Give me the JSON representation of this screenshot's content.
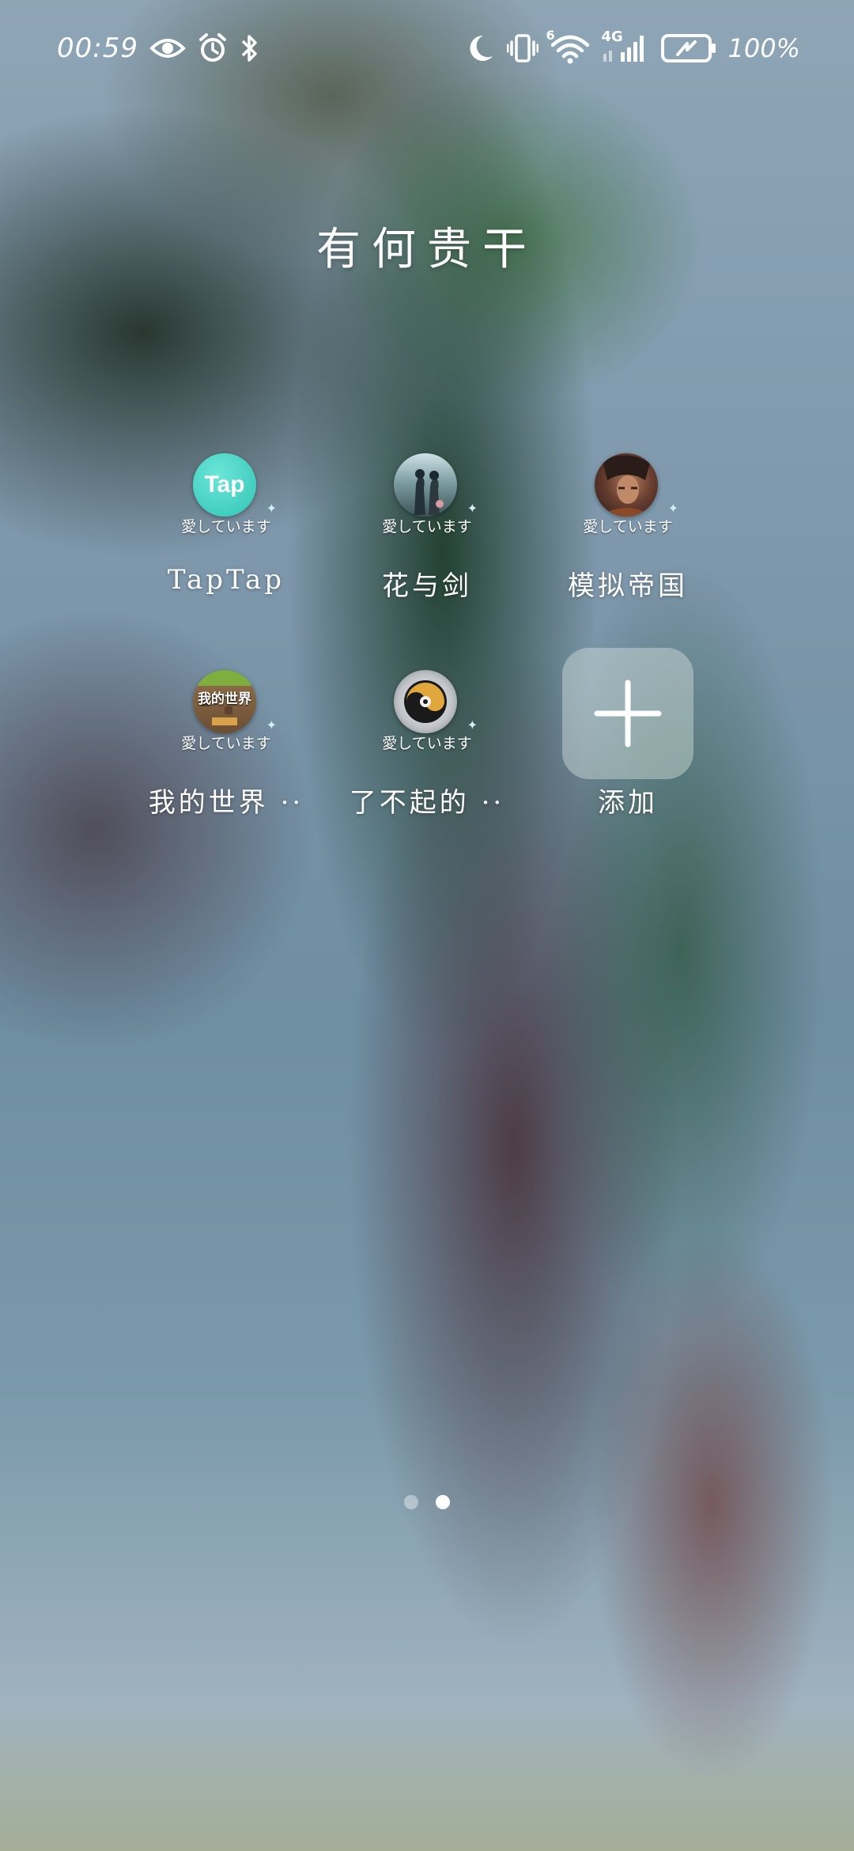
{
  "status_bar": {
    "time": "00:59",
    "battery_text": "100%",
    "network_label": "4G",
    "wifi_label": "6",
    "icons_left": [
      "eye-icon",
      "alarm-icon",
      "bluetooth-icon"
    ],
    "icons_right": [
      "moon-icon",
      "vibrate-icon",
      "wifi-icon",
      "signal-icon",
      "battery-icon"
    ]
  },
  "folder": {
    "title": "有何贵干"
  },
  "apps": [
    {
      "label": "TapTap",
      "badge": "愛しています",
      "icon": "taptap-icon",
      "icon_text": "Tap",
      "color": "#3fd0c2"
    },
    {
      "label": "花与剑",
      "badge": "愛しています",
      "icon": "flower-sword-icon",
      "color": "#6f8e92"
    },
    {
      "label": "模拟帝国",
      "badge": "愛しています",
      "icon": "empire-sim-icon",
      "color": "#5a3a34"
    },
    {
      "label": "我的世界 ··",
      "badge": "愛しています",
      "icon": "minecraft-icon",
      "icon_text": "我的世界",
      "color": "#6b8e3a"
    },
    {
      "label": "了不起的 ··",
      "badge": "愛しています",
      "icon": "amazing-icon",
      "color": "#c9a24a"
    },
    {
      "label": "添加",
      "icon": "plus-icon"
    }
  ],
  "pager": {
    "pages": 2,
    "current": 2
  }
}
